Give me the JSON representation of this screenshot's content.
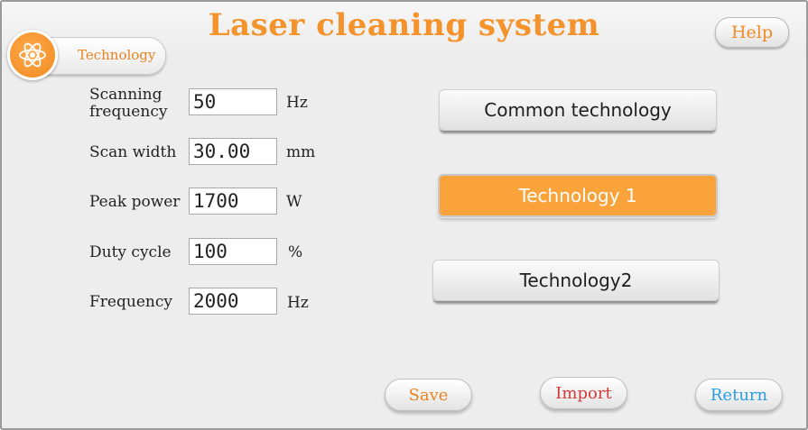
{
  "header": {
    "title": "Laser cleaning system",
    "help_label": "Help"
  },
  "tab": {
    "label": "Technology",
    "icon": "atom-icon"
  },
  "params": [
    {
      "label_line1": "Scanning",
      "label_line2": "frequency",
      "value": "50",
      "unit": "Hz"
    },
    {
      "label_line1": "Scan width",
      "label_line2": "",
      "value": "30.00",
      "unit": "mm"
    },
    {
      "label_line1": "Peak power",
      "label_line2": "",
      "value": "1700",
      "unit": "W"
    },
    {
      "label_line1": "Duty cycle",
      "label_line2": "",
      "value": "100",
      "unit": "%"
    },
    {
      "label_line1": "Frequency",
      "label_line2": "",
      "value": "2000",
      "unit": "Hz"
    }
  ],
  "technology_buttons": {
    "common": "Common technology",
    "tech1": "Technology 1",
    "tech2": "Technology2"
  },
  "actions": {
    "save": "Save",
    "import": "Import",
    "return": "Return"
  },
  "colors": {
    "accent_orange": "#f4922c",
    "selected_button": "#f9a33a",
    "import_text": "#d43a3a",
    "return_text": "#2a9be0"
  }
}
